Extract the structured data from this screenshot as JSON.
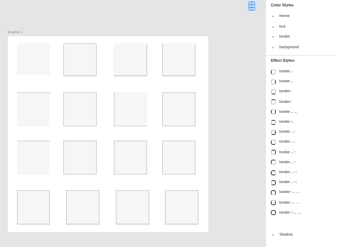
{
  "canvas": {
    "frame_label": "Frame 1",
    "tiles": [
      {
        "name": "tile-r1c1",
        "borders": [],
        "shadow": false
      },
      {
        "name": "tile-r1c2",
        "borders": [
          "top",
          "bottom",
          "left",
          "right"
        ],
        "shadow": true
      },
      {
        "name": "tile-r1c3",
        "borders": [
          "right",
          "bottom"
        ],
        "shadow": true
      },
      {
        "name": "tile-r1c4",
        "borders": [
          "left",
          "right",
          "bottom"
        ],
        "shadow": true
      },
      {
        "name": "tile-r2c1",
        "borders": [
          "top"
        ],
        "shadow": false
      },
      {
        "name": "tile-r2c2",
        "borders": [
          "top",
          "left",
          "right",
          "bottom"
        ],
        "shadow": false
      },
      {
        "name": "tile-r2c3",
        "borders": [
          "left",
          "bottom"
        ],
        "shadow": false
      },
      {
        "name": "tile-r2c4",
        "borders": [
          "top",
          "left",
          "right",
          "bottom"
        ],
        "shadow": false
      },
      {
        "name": "tile-r3c1",
        "borders": [
          "top"
        ],
        "shadow": false
      },
      {
        "name": "tile-r3c2",
        "borders": [
          "top",
          "left",
          "right",
          "bottom"
        ],
        "shadow": false
      },
      {
        "name": "tile-r3c3",
        "borders": [
          "top",
          "left",
          "right",
          "bottom"
        ],
        "shadow": false
      },
      {
        "name": "tile-r3c4",
        "borders": [
          "top",
          "left",
          "right",
          "bottom"
        ],
        "shadow": false
      },
      {
        "name": "tile-r4c1",
        "borders": [
          "top",
          "left",
          "right",
          "bottom"
        ],
        "shadow": true
      },
      {
        "name": "tile-r4c2",
        "borders": [
          "top",
          "left",
          "right",
          "bottom"
        ],
        "shadow": true
      },
      {
        "name": "tile-r4c3",
        "borders": [
          "top",
          "left",
          "right",
          "bottom"
        ],
        "shadow": true
      },
      {
        "name": "tile-r4c4",
        "borders": [
          "top",
          "left",
          "right",
          "bottom"
        ],
        "shadow": true
      }
    ]
  },
  "toolbar": {
    "icon": "component-icon"
  },
  "panel": {
    "color_styles_title": "Color Styles",
    "color_styles": [
      "theme",
      "text",
      "border",
      "background"
    ],
    "effect_styles_title": "Effect Styles",
    "effect_styles": [
      {
        "label": "border←",
        "icon": "border-left-icon"
      },
      {
        "label": "border→",
        "icon": "border-right-icon"
      },
      {
        "label": "border↓",
        "icon": "border-bottom-icon"
      },
      {
        "label": "border↑",
        "icon": "border-top-icon"
      },
      {
        "label": "border←→",
        "icon": "border-left-right-icon"
      },
      {
        "label": "border↑↓",
        "icon": "border-top-bottom-icon"
      },
      {
        "label": "border→↓",
        "icon": "border-right-bottom-icon"
      },
      {
        "label": "border←↓",
        "icon": "border-left-bottom-icon"
      },
      {
        "label": "border→↑",
        "icon": "border-right-top-icon"
      },
      {
        "label": "border←↑",
        "icon": "border-left-top-icon"
      },
      {
        "label": "border←↑↓",
        "icon": "border-left-top-bottom-icon"
      },
      {
        "label": "border→↑↓",
        "icon": "border-right-top-bottom-icon"
      },
      {
        "label": "border↑←→",
        "icon": "border-top-left-right-icon"
      },
      {
        "label": "border↓←→",
        "icon": "border-bottom-left-right-icon"
      },
      {
        "label": "border↑↓←→",
        "icon": "border-all-icon"
      }
    ],
    "shadow_label": "Shadow"
  },
  "colors": {
    "accent_bg": "#d7e7f7",
    "accent": "#2f86d6"
  }
}
